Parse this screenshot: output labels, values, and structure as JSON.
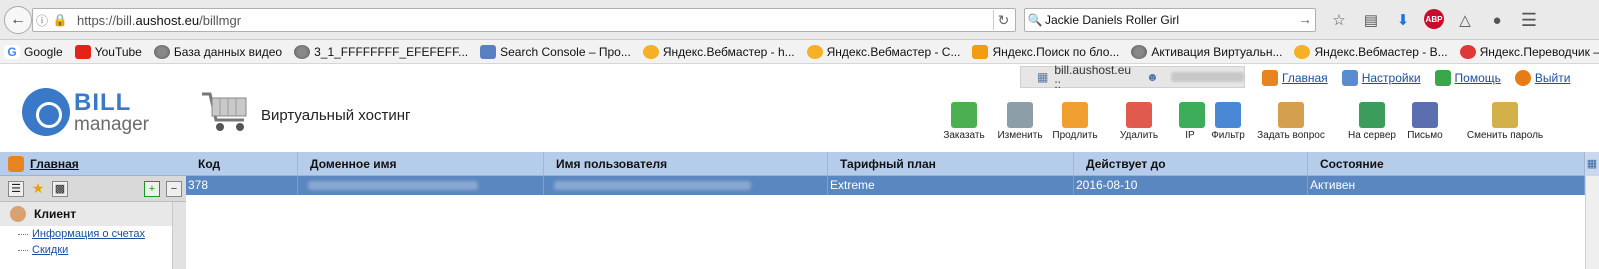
{
  "browser": {
    "url_prefix": "https://bill.",
    "url_host": "aushost.eu",
    "url_path": "/billmgr",
    "search_text": "Jackie Daniels Roller Girl",
    "bookmarks": [
      {
        "label": "Google",
        "icon": "google"
      },
      {
        "label": "YouTube",
        "icon": "yt"
      },
      {
        "label": "База данных видео",
        "icon": "globe"
      },
      {
        "label": "3_1_FFFFFFFF_EFEFEFF...",
        "icon": "globe"
      },
      {
        "label": "Search Console – Про...",
        "icon": "sc"
      },
      {
        "label": "Яндекс.Вебмастер - h...",
        "icon": "ya"
      },
      {
        "label": "Яндекс.Вебмастер - С...",
        "icon": "ya"
      },
      {
        "label": "Яндекс.Поиск по бло...",
        "icon": "blog"
      },
      {
        "label": "Активация Виртуальн...",
        "icon": "globe"
      },
      {
        "label": "Яндекс.Вебмастер - В...",
        "icon": "ya"
      },
      {
        "label": "Яндекс.Переводчик – ...",
        "icon": "tr"
      }
    ]
  },
  "app": {
    "userbar": {
      "host": "bill.aushost.eu ::"
    },
    "toplinks": [
      {
        "label": "Главная",
        "icon": "home"
      },
      {
        "label": "Настройки",
        "icon": "set"
      },
      {
        "label": "Помощь",
        "icon": "help"
      },
      {
        "label": "Выйти",
        "icon": "exit"
      }
    ],
    "logo": {
      "line1": "BILL",
      "line2": "manager"
    },
    "page_title": "Виртуальный хостинг",
    "toolbar": [
      {
        "label": "Заказать",
        "color": "#4caf50"
      },
      {
        "label": "Изменить",
        "color": "#8c9ea8"
      },
      {
        "label": "Продлить",
        "color": "#f0a030"
      },
      {
        "label": "Удалить",
        "color": "#e05a4e"
      },
      {
        "label": "IP",
        "color": "#3cae5a"
      },
      {
        "label": "Фильтр",
        "color": "#4a88d6"
      },
      {
        "label": "Задать вопрос",
        "color": "#d4a050"
      },
      {
        "label": "На сервер",
        "color": "#3c9c5c"
      },
      {
        "label": "Письмо",
        "color": "#5b6fb0"
      },
      {
        "label": "Сменить пароль",
        "color": "#d4b04a"
      }
    ],
    "left_panel": {
      "home_label": "Главная",
      "section_label": "Клиент",
      "links": [
        "Информация о счетах",
        "Скидки"
      ]
    },
    "grid": {
      "columns": [
        "Код",
        "Доменное имя",
        "Имя пользователя",
        "Тарифный план",
        "Действует до",
        "Состояние"
      ],
      "rows": [
        {
          "code": "378",
          "domain": "",
          "username": "",
          "plan": "Extreme",
          "expires": "2016-08-10",
          "status": "Активен"
        }
      ]
    }
  }
}
